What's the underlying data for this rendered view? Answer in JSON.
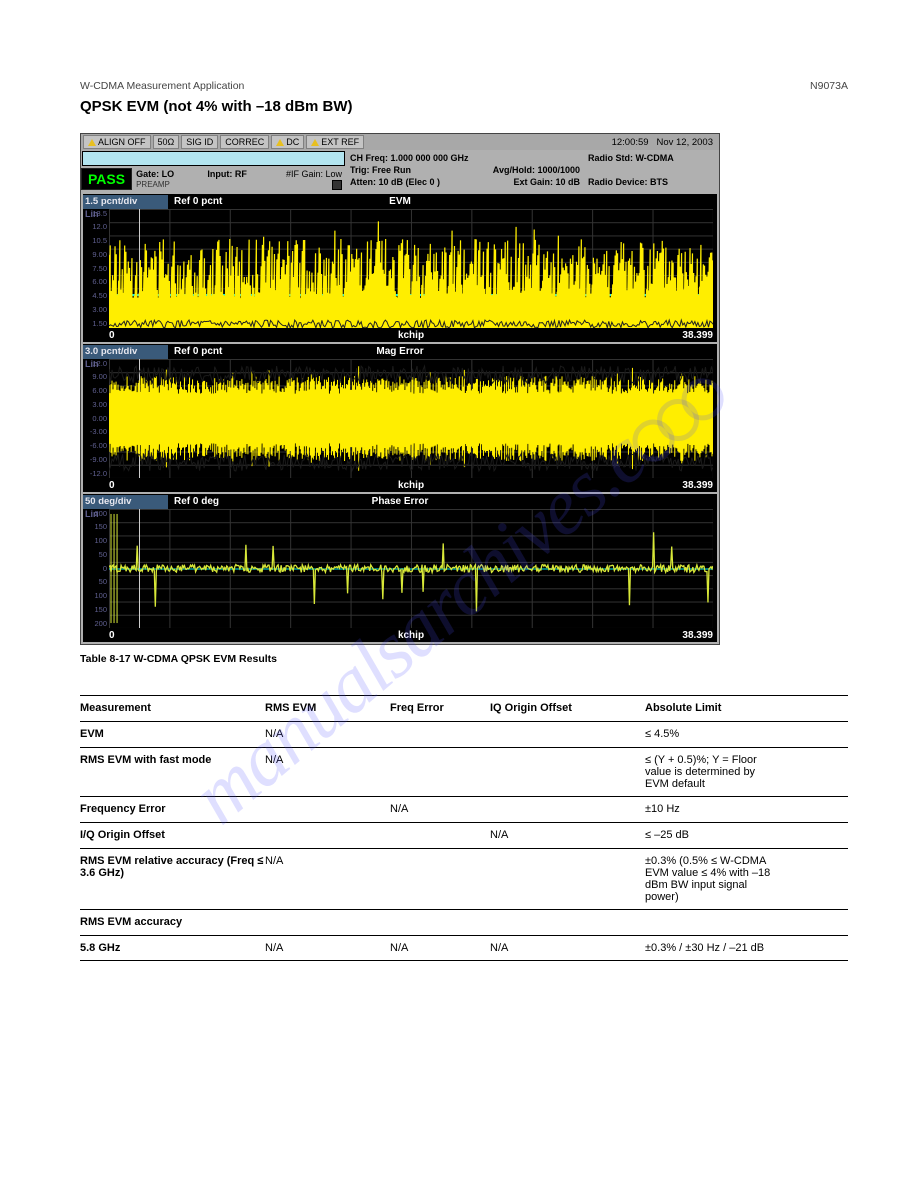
{
  "page_header": {
    "left": "W-CDMA Measurement Application",
    "right": "N9073A"
  },
  "section_title": "QPSK EVM (not 4% with –18 dBm BW)",
  "analyzer": {
    "time": "12:00:59",
    "date": "Nov 12, 2003",
    "status": {
      "align": "ALIGN OFF",
      "ohm": "50Ω",
      "sigid": "SIG ID",
      "correc": "CORREC",
      "dc": "DC",
      "extref": "EXT REF"
    },
    "pass_label": "PASS",
    "settings_left": {
      "gate": "Gate: LO",
      "preamp": "PREAMP",
      "input": "Input: RF",
      "ifgain": "#IF Gain: Low"
    },
    "settings_center": {
      "chfreq": "CH Freq: 1.000 000 000 GHz",
      "trig": "Trig:  Free Run",
      "atten": "Atten: 10 dB (Elec 0 )",
      "avg": "Avg/Hold: 1000/1000",
      "extgain": "Ext Gain: 10 dB"
    },
    "settings_right": {
      "radiostd": "Radio Std: W-CDMA",
      "radiodevice": "Radio Device: BTS"
    },
    "plots": [
      {
        "scale": "1.5 pcnt/div",
        "ref": "Ref 0 pcnt",
        "name": "EVM",
        "ylabels": [
          "13.5",
          "12.0",
          "10.5",
          "9.00",
          "7.50",
          "6.00",
          "4.50",
          "3.00",
          "1.50"
        ],
        "xstart": "0",
        "xunit": "kchip",
        "xend": "38.399",
        "type": "evm"
      },
      {
        "scale": "3.0 pcnt/div",
        "ref": "Ref 0 pcnt",
        "name": "Mag Error",
        "ylabels": [
          "12.0",
          "9.00",
          "6.00",
          "3.00",
          "0.00",
          "-3.00",
          "-6.00",
          "-9.00",
          "-12.0"
        ],
        "xstart": "0",
        "xunit": "kchip",
        "xend": "38.399",
        "type": "mag"
      },
      {
        "scale": "50 deg/div",
        "ref": "Ref 0 deg",
        "name": "Phase Error",
        "ylabels": [
          "200",
          "150",
          "100",
          "50",
          "0",
          "50",
          "100",
          "150",
          "200"
        ],
        "xstart": "0",
        "xunit": "kchip",
        "xend": "38.399",
        "type": "phase"
      }
    ]
  },
  "caption": "Table 8-17    W-CDMA QPSK EVM Results",
  "results_header": [
    "Measurement",
    "RMS EVM",
    "Freq Error",
    "IQ Origin Offset",
    "Absolute Limit"
  ],
  "results": [
    {
      "name": "EVM",
      "rms": "N/A",
      "freq": "",
      "iq": "",
      "limit": "≤ 4.5%"
    },
    {
      "name": "RMS EVM with fast mode",
      "rms": "N/A",
      "freq": "",
      "iq": "",
      "limit": "≤ (Y + 0.5)%; Y = Floor value is determined by EVM default"
    },
    {
      "name": "Frequency Error",
      "rms": "",
      "freq": "N/A",
      "iq": "",
      "limit": "±10 Hz"
    },
    {
      "name": "I/Q Origin Offset",
      "rms": "",
      "freq": "",
      "iq": "N/A",
      "limit": "≤ –25 dB"
    },
    {
      "name": "RMS EVM relative accuracy (Freq ≤ 3.6 GHz)",
      "rms": "N/A",
      "freq": "",
      "iq": "",
      "limit": "±0.3% (0.5% ≤ W-CDMA EVM value ≤ 4% with –18 dBm BW input signal power)"
    },
    {
      "name": "RMS EVM accuracy",
      "rms": "",
      "freq": "",
      "iq": "",
      "limit": ""
    },
    {
      "name": "5.8 GHz",
      "rms": "N/A",
      "freq": "N/A",
      "iq": "N/A",
      "limit": "±0.3% / ±30 Hz / –21 dB"
    }
  ],
  "watermark": "manualsarchives.c"
}
